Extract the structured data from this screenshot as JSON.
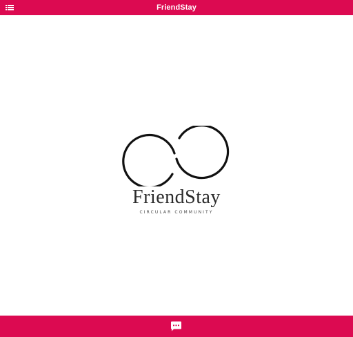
{
  "header": {
    "title": "FriendStay",
    "menu_icon": "list-menu-icon"
  },
  "logo": {
    "wordmark": "FriendStay",
    "tagline": "CIRCULAR COMMUNITY",
    "symbol_icon": "infinity-loop-icon"
  },
  "footer": {
    "chat_icon": "chat-bubble-icon"
  },
  "colors": {
    "brand": "#dc0a51",
    "background": "#ffffff",
    "logo_ink": "#111111"
  }
}
